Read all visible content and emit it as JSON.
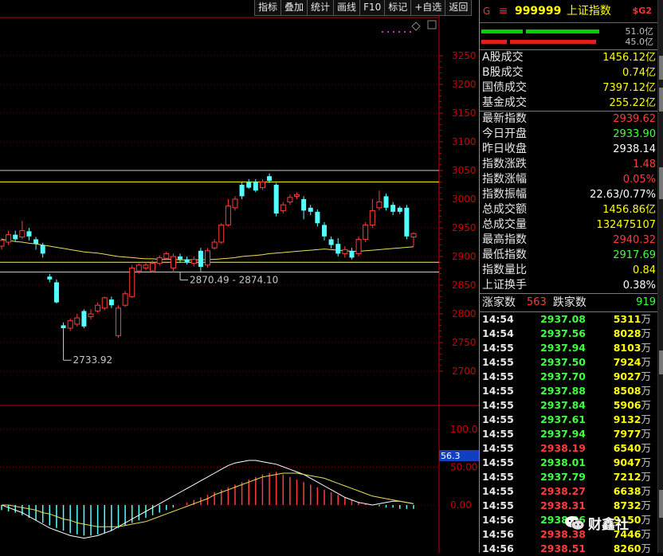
{
  "toolbar": {
    "buttons": [
      "指标",
      "叠加",
      "统计",
      "画线",
      "F10",
      "标记",
      "+自选",
      "返回"
    ]
  },
  "colors": {
    "up": "#ff3c3c",
    "down": "#54ffff",
    "ma": "#e6e05a",
    "axis": "#c00000",
    "grid": "#700000",
    "green": "#40ff40",
    "yellow": "#ffff00"
  },
  "chart_data": {
    "type": "candlestick",
    "price_axis": {
      "ticks": [
        3250,
        3200,
        3150,
        3100,
        3050,
        3000,
        2950,
        2900,
        2850,
        2800,
        2750,
        2700
      ]
    },
    "candles": [
      {
        "o": 2918,
        "c": 2928,
        "h": 2932,
        "l": 2912
      },
      {
        "o": 2925,
        "c": 2938,
        "h": 2945,
        "l": 2920
      },
      {
        "o": 2938,
        "c": 2930,
        "h": 2945,
        "l": 2926
      },
      {
        "o": 2934,
        "c": 2945,
        "h": 2962,
        "l": 2930
      },
      {
        "o": 2944,
        "c": 2935,
        "h": 2950,
        "l": 2928
      },
      {
        "o": 2930,
        "c": 2922,
        "h": 2934,
        "l": 2912
      },
      {
        "o": 2920,
        "c": 2905,
        "h": 2924,
        "l": 2898
      },
      {
        "o": 2865,
        "c": 2860,
        "h": 2870,
        "l": 2855
      },
      {
        "o": 2855,
        "c": 2820,
        "h": 2860,
        "l": 2818
      },
      {
        "o": 2780,
        "c": 2775,
        "h": 2785,
        "l": 2733
      },
      {
        "o": 2775,
        "c": 2788,
        "h": 2792,
        "l": 2770
      },
      {
        "o": 2782,
        "c": 2793,
        "h": 2800,
        "l": 2778
      },
      {
        "o": 2805,
        "c": 2778,
        "h": 2808,
        "l": 2775
      },
      {
        "o": 2795,
        "c": 2800,
        "h": 2808,
        "l": 2790
      },
      {
        "o": 2805,
        "c": 2815,
        "h": 2820,
        "l": 2802
      },
      {
        "o": 2810,
        "c": 2828,
        "h": 2830,
        "l": 2806
      },
      {
        "o": 2825,
        "c": 2815,
        "h": 2830,
        "l": 2810
      },
      {
        "o": 2762,
        "c": 2810,
        "h": 2815,
        "l": 2758
      },
      {
        "o": 2815,
        "c": 2835,
        "h": 2840,
        "l": 2812
      },
      {
        "o": 2830,
        "c": 2880,
        "h": 2885,
        "l": 2828
      },
      {
        "o": 2875,
        "c": 2885,
        "h": 2888,
        "l": 2870
      },
      {
        "o": 2880,
        "c": 2885,
        "h": 2890,
        "l": 2876
      },
      {
        "o": 2875,
        "c": 2888,
        "h": 2893,
        "l": 2872
      },
      {
        "o": 2888,
        "c": 2898,
        "h": 2902,
        "l": 2884
      },
      {
        "o": 2897,
        "c": 2905,
        "h": 2908,
        "l": 2895
      },
      {
        "o": 2880,
        "c": 2900,
        "h": 2905,
        "l": 2872
      },
      {
        "o": 2900,
        "c": 2895,
        "h": 2905,
        "l": 2890
      },
      {
        "o": 2895,
        "c": 2890,
        "h": 2900,
        "l": 2886
      },
      {
        "o": 2888,
        "c": 2895,
        "h": 2900,
        "l": 2883
      },
      {
        "o": 2910,
        "c": 2882,
        "h": 2915,
        "l": 2874
      },
      {
        "o": 2885,
        "c": 2910,
        "h": 2915,
        "l": 2880
      },
      {
        "o": 2915,
        "c": 2925,
        "h": 2930,
        "l": 2912
      },
      {
        "o": 2925,
        "c": 2955,
        "h": 2958,
        "l": 2922
      },
      {
        "o": 2955,
        "c": 2988,
        "h": 3000,
        "l": 2952
      },
      {
        "o": 2985,
        "c": 3000,
        "h": 3005,
        "l": 2980
      },
      {
        "o": 3025,
        "c": 3005,
        "h": 3030,
        "l": 3000
      },
      {
        "o": 3030,
        "c": 3020,
        "h": 3035,
        "l": 3018
      },
      {
        "o": 3030,
        "c": 3015,
        "h": 3035,
        "l": 3012
      },
      {
        "o": 3020,
        "c": 3030,
        "h": 3035,
        "l": 3016
      },
      {
        "o": 3040,
        "c": 3032,
        "h": 3045,
        "l": 3028
      },
      {
        "o": 3025,
        "c": 2975,
        "h": 3028,
        "l": 2970
      },
      {
        "o": 2980,
        "c": 2990,
        "h": 2995,
        "l": 2975
      },
      {
        "o": 2995,
        "c": 3003,
        "h": 3008,
        "l": 2990
      },
      {
        "o": 3005,
        "c": 3008,
        "h": 3012,
        "l": 3000
      },
      {
        "o": 3000,
        "c": 2980,
        "h": 3005,
        "l": 2965
      },
      {
        "o": 2985,
        "c": 2978,
        "h": 2990,
        "l": 2972
      },
      {
        "o": 2978,
        "c": 2958,
        "h": 2982,
        "l": 2952
      },
      {
        "o": 2955,
        "c": 2935,
        "h": 2960,
        "l": 2928
      },
      {
        "o": 2930,
        "c": 2920,
        "h": 2935,
        "l": 2914
      },
      {
        "o": 2922,
        "c": 2905,
        "h": 2932,
        "l": 2900
      },
      {
        "o": 2905,
        "c": 2912,
        "h": 2918,
        "l": 2898
      },
      {
        "o": 2910,
        "c": 2898,
        "h": 2915,
        "l": 2895
      },
      {
        "o": 2905,
        "c": 2930,
        "h": 2935,
        "l": 2900
      },
      {
        "o": 2930,
        "c": 2955,
        "h": 2960,
        "l": 2925
      },
      {
        "o": 2955,
        "c": 2980,
        "h": 3000,
        "l": 2950
      },
      {
        "o": 2985,
        "c": 2995,
        "h": 3015,
        "l": 2980
      },
      {
        "o": 3005,
        "c": 2985,
        "h": 3010,
        "l": 2980
      },
      {
        "o": 2990,
        "c": 2978,
        "h": 2995,
        "l": 2972
      },
      {
        "o": 2985,
        "c": 2978,
        "h": 2988,
        "l": 2974
      },
      {
        "o": 2985,
        "c": 2935,
        "h": 2990,
        "l": 2930
      },
      {
        "o": 2934,
        "c": 2940,
        "h": 2942,
        "l": 2918
      }
    ],
    "ma_line": [
      2930,
      2928,
      2926,
      2925,
      2923,
      2922,
      2920,
      2918,
      2916,
      2914,
      2912,
      2910,
      2908,
      2907,
      2906,
      2904,
      2902,
      2900,
      2899,
      2898,
      2897,
      2896,
      2896,
      2895,
      2895,
      2895,
      2894,
      2894,
      2894,
      2894,
      2895,
      2895,
      2896,
      2897,
      2898,
      2900,
      2901,
      2902,
      2903,
      2905,
      2906,
      2907,
      2908,
      2909,
      2910,
      2911,
      2912,
      2913,
      2912,
      2911,
      2910,
      2909,
      2909,
      2910,
      2911,
      2912,
      2913,
      2914,
      2915,
      2916,
      2917
    ],
    "horizontal_lines": [
      3050,
      3030,
      2890,
      2873
    ],
    "annotations": [
      {
        "label": "2870.49 - 2874.10",
        "price": 2873,
        "index": 26
      },
      {
        "label": "2733.92",
        "price": 2733,
        "index": 9
      }
    ],
    "indicator_axis": {
      "ticks": [
        "100.0",
        "50.00",
        "0.00"
      ],
      "marker": "56.3"
    },
    "macd_hist": [
      -4,
      -5,
      -6,
      -8,
      -10,
      -12,
      -14,
      -16,
      -18,
      -20,
      -22,
      -23,
      -24,
      -24,
      -23,
      -22,
      -20,
      -18,
      -16,
      -14,
      -12,
      -10,
      -8,
      -6,
      -4,
      -2,
      0,
      2,
      4,
      6,
      8,
      10,
      12,
      14,
      16,
      18,
      20,
      22,
      24,
      25,
      26,
      24,
      22,
      20,
      18,
      16,
      14,
      12,
      10,
      8,
      6,
      4,
      2,
      1,
      0,
      -1,
      -2,
      -2,
      -3,
      -3,
      -3
    ],
    "dif_line": [
      0,
      -2,
      -4,
      -6,
      -9,
      -12,
      -15,
      -18,
      -20,
      -22,
      -24,
      -25,
      -26,
      -25,
      -24,
      -22,
      -20,
      -17,
      -14,
      -11,
      -8,
      -5,
      -2,
      1,
      4,
      7,
      10,
      13,
      16,
      19,
      22,
      25,
      28,
      31,
      33,
      34,
      35,
      35,
      34,
      33,
      32,
      30,
      28,
      26,
      24,
      21,
      18,
      15,
      12,
      9,
      6,
      4,
      2,
      1,
      0,
      1,
      2,
      3,
      3,
      2,
      1
    ],
    "dea_line": [
      0,
      0,
      -1,
      -2,
      -3,
      -4,
      -6,
      -7,
      -9,
      -11,
      -12,
      -14,
      -15,
      -16,
      -17,
      -17,
      -17,
      -17,
      -16,
      -15,
      -14,
      -13,
      -11,
      -9,
      -7,
      -5,
      -3,
      -1,
      1,
      3,
      5,
      8,
      10,
      12,
      14,
      16,
      18,
      20,
      22,
      23,
      24,
      25,
      25,
      25,
      24,
      23,
      22,
      21,
      19,
      17,
      15,
      13,
      11,
      9,
      7,
      6,
      5,
      4,
      3,
      2,
      1
    ]
  },
  "panel": {
    "title": {
      "g": "G",
      "menu": "≡",
      "code": "999999",
      "name": "上证指数",
      "badge": "$G2"
    },
    "bars": [
      {
        "pct": "51.0亿",
        "segs": [
          {
            "x": 2,
            "w": 52,
            "c": "#00d000"
          },
          {
            "x": 58,
            "w": 92,
            "c": "#00d000"
          }
        ]
      },
      {
        "pct": "45.0亿",
        "segs": [
          {
            "x": 2,
            "w": 32,
            "c": "#e02020"
          },
          {
            "x": 38,
            "w": 108,
            "c": "#e02020"
          }
        ]
      }
    ],
    "turnover": [
      {
        "k": "A股成交",
        "v": "1456.12亿",
        "cls": "v-yellow"
      },
      {
        "k": "B股成交",
        "v": "0.74亿",
        "cls": "v-yellow"
      },
      {
        "k": "国债成交",
        "v": "7397.12亿",
        "cls": "v-yellow"
      },
      {
        "k": "基金成交",
        "v": "255.22亿",
        "cls": "v-yellow"
      }
    ],
    "stats": [
      {
        "k": "最新指数",
        "v": "2939.62",
        "cls": "v-red"
      },
      {
        "k": "今日开盘",
        "v": "2933.90",
        "cls": "v-green"
      },
      {
        "k": "昨日收盘",
        "v": "2938.14",
        "cls": "v-white"
      },
      {
        "k": "指数涨跌",
        "v": "1.48",
        "cls": "v-red"
      },
      {
        "k": "指数涨幅",
        "v": "0.05%",
        "cls": "v-red"
      },
      {
        "k": "指数振幅",
        "v": "22.63/0.77%",
        "cls": "v-white"
      },
      {
        "k": "总成交额",
        "v": "1456.86亿",
        "cls": "v-yellow"
      },
      {
        "k": "总成交量",
        "v": "132475107",
        "cls": "v-yellow"
      },
      {
        "k": "最高指数",
        "v": "2940.32",
        "cls": "v-red"
      },
      {
        "k": "最低指数",
        "v": "2917.69",
        "cls": "v-green"
      },
      {
        "k": "指数量比",
        "v": "0.84",
        "cls": "v-yellow"
      },
      {
        "k": "上证换手",
        "v": "0.38%",
        "cls": "v-white"
      }
    ],
    "updown": {
      "up_label": "涨家数",
      "up": "563",
      "down_label": "跌家数",
      "down": "919"
    },
    "ticks": [
      {
        "t": "14:54",
        "p": "2937.08",
        "d": "down",
        "v": "5311",
        "u": "万"
      },
      {
        "t": "14:54",
        "p": "2937.56",
        "d": "down",
        "v": "8028",
        "u": "万"
      },
      {
        "t": "14:55",
        "p": "2937.94",
        "d": "down",
        "v": "8103",
        "u": "万"
      },
      {
        "t": "14:55",
        "p": "2937.50",
        "d": "down",
        "v": "7924",
        "u": "万"
      },
      {
        "t": "14:55",
        "p": "2937.70",
        "d": "down",
        "v": "9027",
        "u": "万"
      },
      {
        "t": "14:55",
        "p": "2937.88",
        "d": "down",
        "v": "8508",
        "u": "万"
      },
      {
        "t": "14:55",
        "p": "2937.84",
        "d": "down",
        "v": "5906",
        "u": "万"
      },
      {
        "t": "14:55",
        "p": "2937.61",
        "d": "down",
        "v": "9132",
        "u": "万"
      },
      {
        "t": "14:55",
        "p": "2937.94",
        "d": "down",
        "v": "7977",
        "u": "万"
      },
      {
        "t": "14:55",
        "p": "2938.19",
        "d": "up",
        "v": "6540",
        "u": "万"
      },
      {
        "t": "14:55",
        "p": "2938.01",
        "d": "down",
        "v": "9047",
        "u": "万"
      },
      {
        "t": "14:55",
        "p": "2937.79",
        "d": "down",
        "v": "7212",
        "u": "万"
      },
      {
        "t": "14:55",
        "p": "2938.27",
        "d": "up",
        "v": "6638",
        "u": "万"
      },
      {
        "t": "14:55",
        "p": "2938.31",
        "d": "up",
        "v": "8732",
        "u": "万"
      },
      {
        "t": "14:56",
        "p": "2938.06",
        "d": "down",
        "v": "9150",
        "u": "万"
      },
      {
        "t": "14:56",
        "p": "2938.38",
        "d": "up",
        "v": "7446",
        "u": "万"
      },
      {
        "t": "14:56",
        "p": "2938.51",
        "d": "up",
        "v": "8260",
        "u": "万"
      }
    ]
  },
  "watermark": {
    "text": "财鑫社"
  }
}
